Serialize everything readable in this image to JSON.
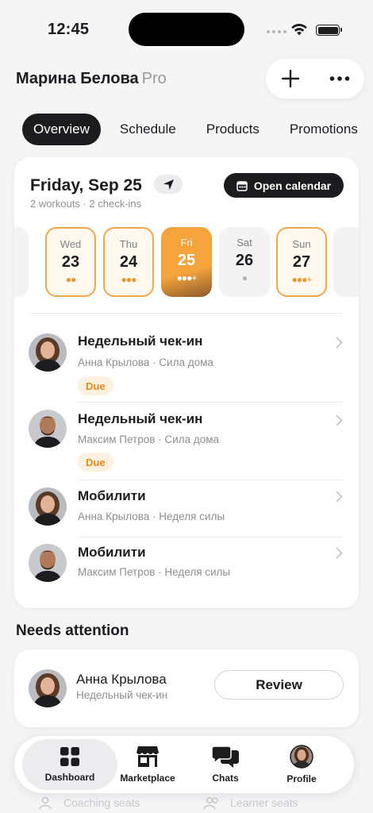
{
  "status_bar": {
    "time": "12:45"
  },
  "header": {
    "name": "Марина Белова",
    "plan": "Pro"
  },
  "tabs": [
    {
      "label": "Overview",
      "active": true
    },
    {
      "label": "Schedule",
      "active": false
    },
    {
      "label": "Products",
      "active": false
    },
    {
      "label": "Promotions",
      "active": false
    }
  ],
  "schedule": {
    "date_title": "Friday, Sep 25",
    "summary": "2 workouts · 2 check-ins",
    "open_calendar_label": "Open calendar",
    "days": [
      {
        "dow": "Wed",
        "num": "23",
        "dots": "●●",
        "style": "outlined"
      },
      {
        "dow": "Thu",
        "num": "24",
        "dots": "●●●",
        "style": "outlined"
      },
      {
        "dow": "Fri",
        "num": "25",
        "dots": "●●●+",
        "style": "selected"
      },
      {
        "dow": "Sat",
        "num": "26",
        "dots": "●",
        "style": "plain"
      },
      {
        "dow": "Sun",
        "num": "27",
        "dots": "●●●+",
        "style": "outlined"
      }
    ],
    "items": [
      {
        "title": "Недельный чек-ин",
        "subtitle": "Анна Крылова · Сила дома",
        "badge": "Due",
        "person": "female"
      },
      {
        "title": "Недельный чек-ин",
        "subtitle": "Максим Петров · Сила дома",
        "badge": "Due",
        "person": "male"
      },
      {
        "title": "Мобилити",
        "subtitle": "Анна Крылова · Неделя силы",
        "badge": "",
        "person": "female"
      },
      {
        "title": "Мобилити",
        "subtitle": "Максим Петров · Неделя силы",
        "badge": "",
        "person": "male"
      }
    ]
  },
  "attention": {
    "title": "Needs attention",
    "name": "Анна Крылова",
    "subtitle": "Недельный чек-ин",
    "review_label": "Review"
  },
  "behind_nav": {
    "left": "Coaching seats",
    "right": "Learner seats"
  },
  "nav": [
    {
      "label": "Dashboard",
      "icon": "dashboard-icon",
      "active": true
    },
    {
      "label": "Marketplace",
      "icon": "storefront-icon",
      "active": false
    },
    {
      "label": "Chats",
      "icon": "chat-bubbles-icon",
      "active": false
    },
    {
      "label": "Profile",
      "icon": "profile-avatar",
      "active": false
    }
  ],
  "colors": {
    "accent": "#f5a43b",
    "due_bg": "#fff1df",
    "due_text": "#e08a1d",
    "dark": "#1c1c1e"
  }
}
